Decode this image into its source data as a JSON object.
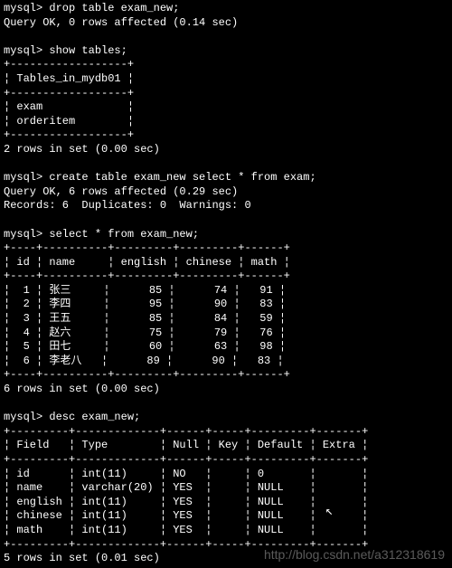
{
  "prompt": "mysql>",
  "commands": {
    "drop": "drop table exam_new;",
    "show": "show tables;",
    "create": "create table exam_new select * from exam;",
    "select": "select * from exam_new;",
    "desc": "desc exam_new;"
  },
  "responses": {
    "drop": "Query OK, 0 rows affected (0.14 sec)",
    "create1": "Query OK, 6 rows affected (0.29 sec)",
    "create2": "Records: 6  Duplicates: 0  Warnings: 0",
    "show_footer": "2 rows in set (0.00 sec)",
    "select_footer": "6 rows in set (0.00 sec)",
    "desc_footer": "5 rows in set (0.01 sec)"
  },
  "tables_header": "Tables_in_mydb01",
  "tables_rows": [
    "exam",
    "orderitem"
  ],
  "chart_data": {
    "type": "table",
    "tables": [
      {
        "name": "show tables",
        "columns": [
          "Tables_in_mydb01"
        ],
        "rows": [
          [
            "exam"
          ],
          [
            "orderitem"
          ]
        ]
      },
      {
        "name": "select * from exam_new",
        "columns": [
          "id",
          "name",
          "english",
          "chinese",
          "math"
        ],
        "rows": [
          [
            1,
            "张三",
            85,
            74,
            91
          ],
          [
            2,
            "李四",
            95,
            90,
            83
          ],
          [
            3,
            "王五",
            85,
            84,
            59
          ],
          [
            4,
            "赵六",
            75,
            79,
            76
          ],
          [
            5,
            "田七",
            60,
            63,
            98
          ],
          [
            6,
            "李老八",
            89,
            90,
            83
          ]
        ]
      },
      {
        "name": "desc exam_new",
        "columns": [
          "Field",
          "Type",
          "Null",
          "Key",
          "Default",
          "Extra"
        ],
        "rows": [
          [
            "id",
            "int(11)",
            "NO",
            "",
            "0",
            ""
          ],
          [
            "name",
            "varchar(20)",
            "YES",
            "",
            "NULL",
            ""
          ],
          [
            "english",
            "int(11)",
            "YES",
            "",
            "NULL",
            ""
          ],
          [
            "chinese",
            "int(11)",
            "YES",
            "",
            "NULL",
            ""
          ],
          [
            "math",
            "int(11)",
            "YES",
            "",
            "NULL",
            ""
          ]
        ]
      }
    ]
  },
  "watermark": "http://blog.csdn.net/a312318619"
}
